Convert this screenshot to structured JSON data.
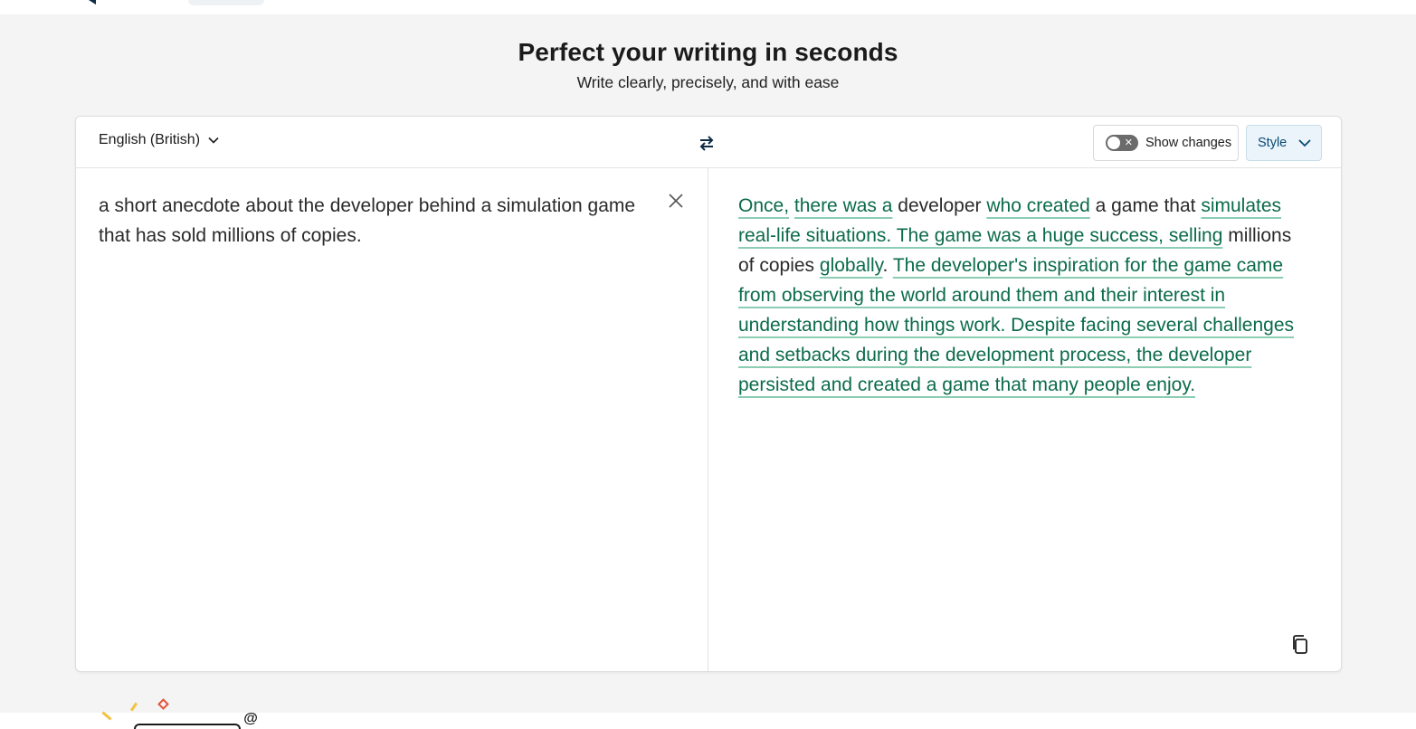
{
  "hero": {
    "title": "Perfect your writing in seconds",
    "subtitle": "Write clearly, precisely, and with ease"
  },
  "toolbar": {
    "language": "English (British)",
    "show_changes_label": "Show changes",
    "show_changes_enabled": false,
    "style_label": "Style"
  },
  "input": {
    "text": "a short anecdote about the developer behind a simulation game that has sold millions of copies."
  },
  "output": {
    "segments": [
      {
        "text": "Once,",
        "changed": true
      },
      {
        "text": " ",
        "changed": false
      },
      {
        "text": "there was a",
        "changed": true
      },
      {
        "text": " developer ",
        "changed": false
      },
      {
        "text": "who created",
        "changed": true
      },
      {
        "text": " a game that ",
        "changed": false
      },
      {
        "text": "simulates real-life situations. The game was a huge success, selling",
        "changed": true
      },
      {
        "text": " millions of copies ",
        "changed": false
      },
      {
        "text": "globally",
        "changed": true
      },
      {
        "text": ". ",
        "changed": false
      },
      {
        "text": "The developer's inspiration for the game came from observing the world around them and their interest in understanding how things work. Despite facing several challenges and setbacks during the development process, the developer persisted and created a game that many people enjoy.",
        "changed": true
      }
    ]
  },
  "icons": {
    "language_chevron": "chevron-down-icon",
    "swap": "swap-icon",
    "clear": "close-icon",
    "copy": "copy-icon",
    "style_chevron": "chevron-down-icon"
  },
  "colors": {
    "changed_text": "#0b6b4a",
    "changed_underline": "#8ccdb4",
    "style_button_bg": "#eaf4fa",
    "background": "#f4f4f4"
  }
}
